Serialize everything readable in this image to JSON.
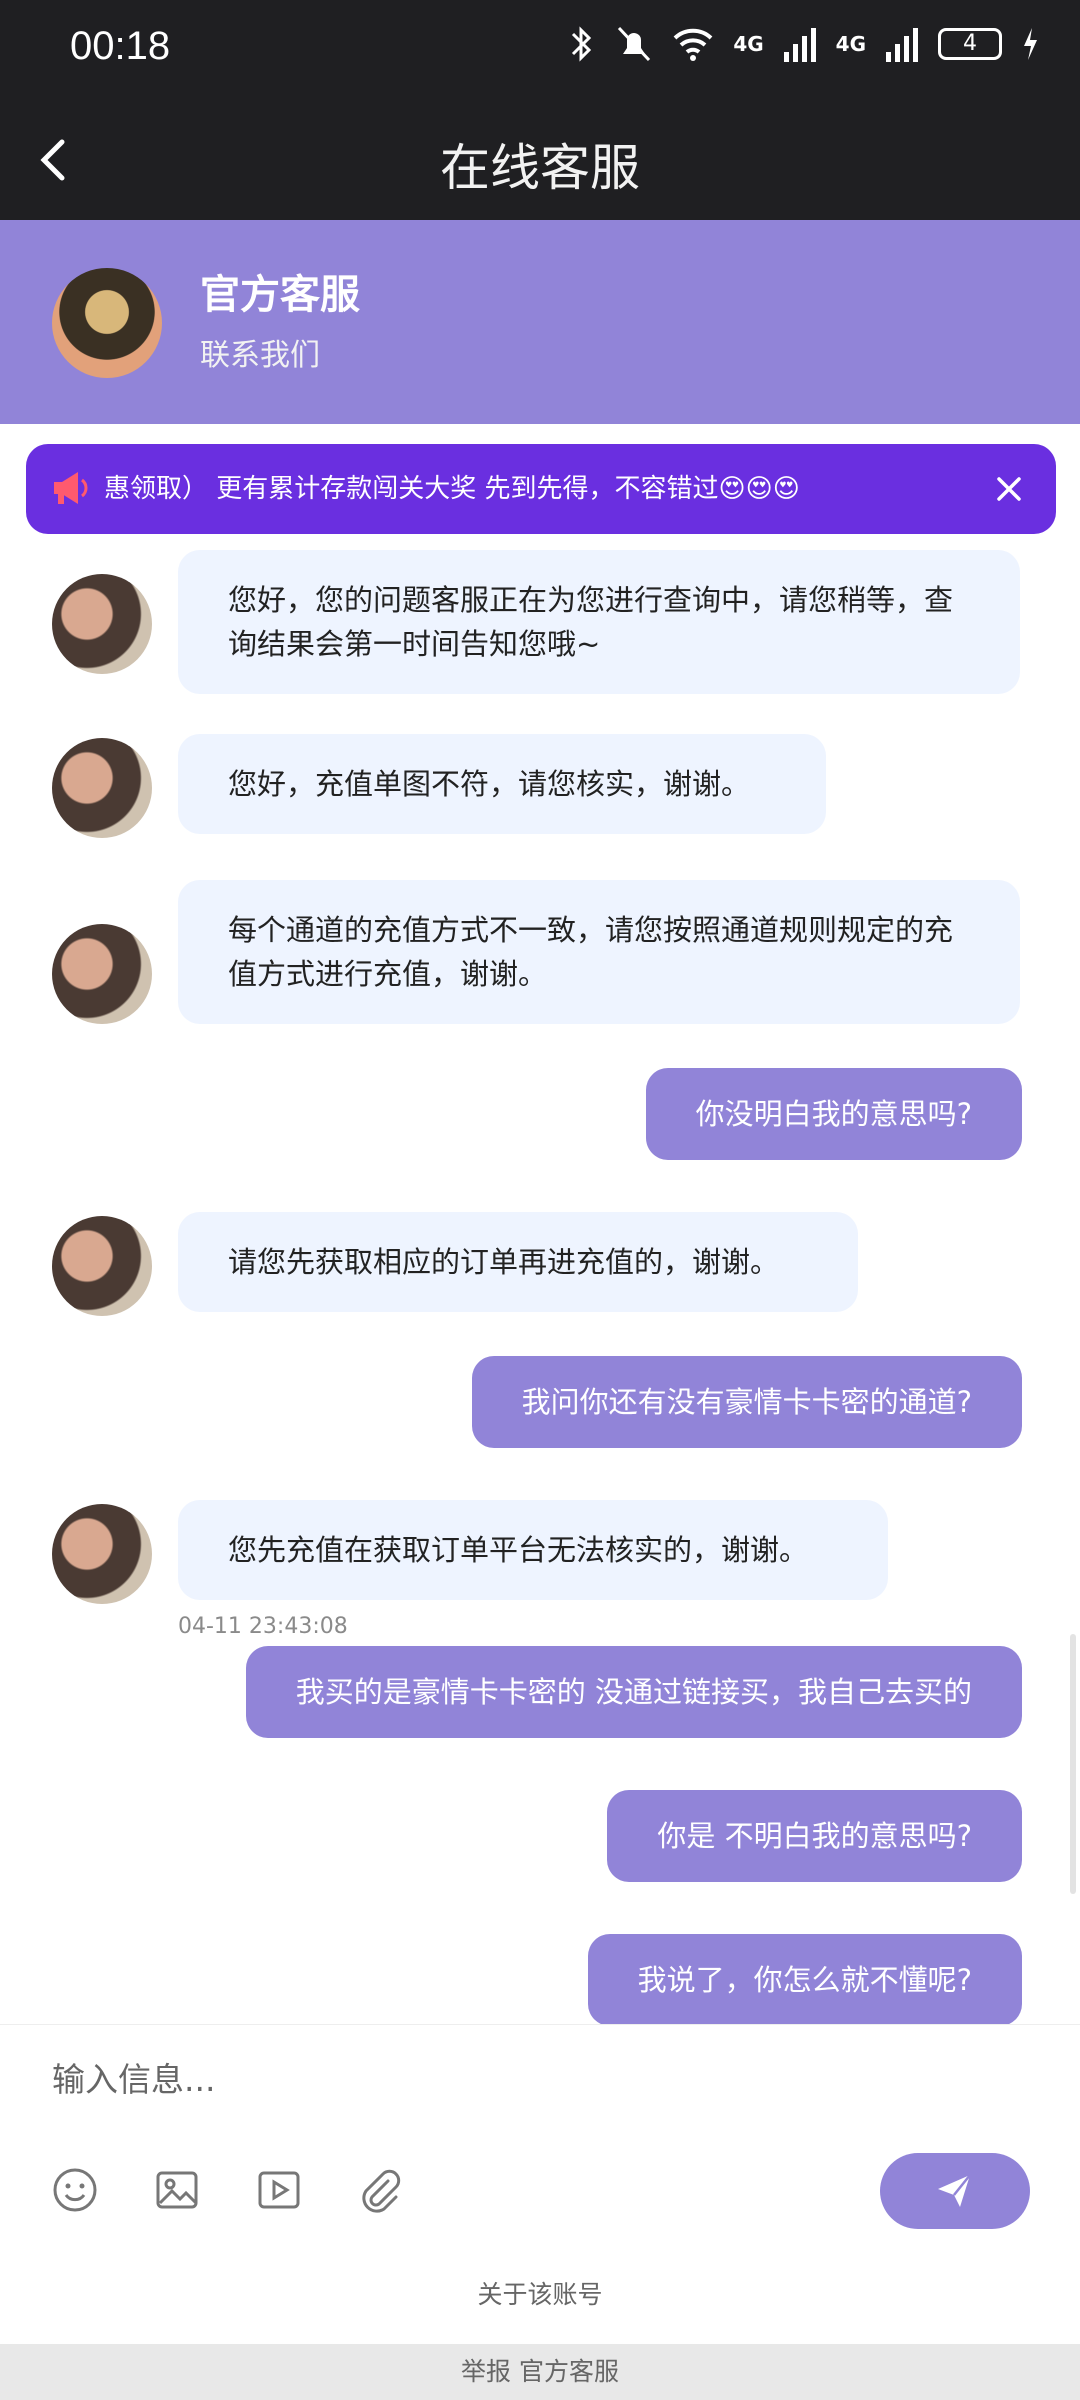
{
  "status_bar": {
    "time": "00:18",
    "net1": "4G",
    "net2": "4G",
    "battery": "4"
  },
  "title_bar": {
    "title": "在线客服"
  },
  "header": {
    "name": "官方客服",
    "subtitle": "联系我们"
  },
  "promo": {
    "text": "惠领取）  更有累计存款闯关大奖 先到先得，不容错过😍😍😍"
  },
  "messages": [
    {
      "from": "agent",
      "text": "您好，您的问题客服正在为您进行查询中，请您稍等，查询结果会第一时间告知您哦~"
    },
    {
      "from": "agent",
      "text": "您好，充值单图不符，请您核实，谢谢。"
    },
    {
      "from": "agent",
      "text": "每个通道的充值方式不一致，请您按照通道规则规定的充值方式进行充值，谢谢。"
    },
    {
      "from": "user",
      "text": "你没明白我的意思吗?"
    },
    {
      "from": "agent",
      "text": "请您先获取相应的订单再进充值的，谢谢。"
    },
    {
      "from": "user",
      "text": "我问你还有没有豪情卡卡密的通道?"
    },
    {
      "from": "agent",
      "text": "您先充值在获取订单平台无法核实的，谢谢。",
      "timestamp": "04-11 23:43:08"
    },
    {
      "from": "user",
      "text": "我买的是豪情卡卡密的 没通过链接买，我自己去买的"
    },
    {
      "from": "user",
      "text": "你是 不明白我的意思吗?"
    },
    {
      "from": "user",
      "text": "我说了，你怎么就不懂呢?"
    }
  ],
  "input": {
    "placeholder": "输入信息..."
  },
  "toolbar": {
    "icons": [
      "emoji-icon",
      "image-icon",
      "video-icon",
      "attachment-icon",
      "send-icon"
    ]
  },
  "footer": {
    "about": "关于该账号",
    "report": "举报 官方客服"
  },
  "colors": {
    "accent": "#9184d8",
    "promo": "#6a2fe0",
    "agent_bubble": "#eef4ff",
    "dark_bar": "#1f1f22"
  }
}
